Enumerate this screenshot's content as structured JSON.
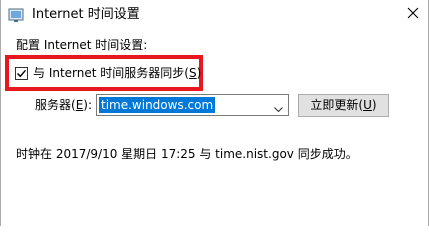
{
  "window": {
    "title": "Internet 时间设置",
    "icon": "internet-time-icon",
    "close_icon": "close-icon"
  },
  "section": {
    "label": "配置 Internet 时间设置:"
  },
  "sync": {
    "checked": true,
    "label_prefix": "与 Internet 时间服务器同步(",
    "access_key": "S",
    "label_suffix": ")"
  },
  "server": {
    "label_prefix": "服务器(",
    "access_key": "E",
    "label_suffix": "):",
    "value": "time.windows.com"
  },
  "update_button": {
    "label_prefix": "立即更新(",
    "access_key": "U",
    "label_suffix": ")"
  },
  "status": {
    "text": "时钟在 2017/9/10 星期日 17:25 与 time.nist.gov 同步成功。"
  },
  "colors": {
    "highlight_border": "#e8171f",
    "selection": "#0078d7"
  }
}
